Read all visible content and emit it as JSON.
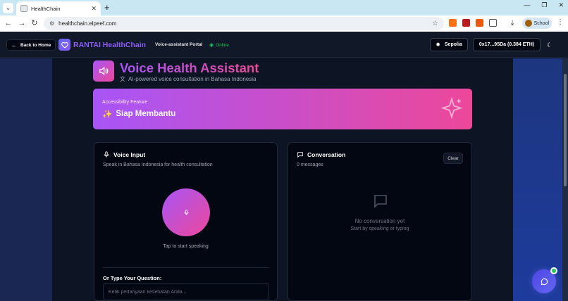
{
  "browser": {
    "tab_title": "HealthChain",
    "url": "healthchain.elpeef.com",
    "profile_label": "School"
  },
  "header": {
    "back_label": "Back to Home",
    "brand_name": "RANTAI HealthChain",
    "portal_label": "Voice-assistant Portal",
    "status_label": "Online",
    "network_label": "Sepolia",
    "wallet_label": "0x17...95Da (0.384 ETH)"
  },
  "hero": {
    "title": "Voice Health Assistant",
    "subtitle": "AI-powered voice consultation in Bahasa Indonesia"
  },
  "banner": {
    "label": "Accessibility Feature",
    "title": "Siap Membantu",
    "emoji": "✨"
  },
  "voice_card": {
    "title": "Voice Input",
    "subtitle": "Speak in Bahasa Indonesia for health consultation",
    "tap_label": "Tap to start speaking",
    "type_label": "Or Type Your Question:",
    "input_placeholder": "Ketik pertanyaan kesehatan Anda...",
    "input_value": ""
  },
  "conversation_card": {
    "title": "Conversation",
    "count_label": "0 messages",
    "clear_label": "Clear",
    "empty_title": "No conversation yet",
    "empty_subtitle": "Start by speaking or typing"
  },
  "colors": {
    "accent_purple": "#a855f7",
    "accent_pink": "#ec4899",
    "brand_indigo": "#8b5cf6",
    "online_green": "#22c55e",
    "background": "#0b1120"
  },
  "icons": {
    "back": "arrow-left-icon",
    "brand": "heart-icon",
    "network": "sun-icon",
    "theme": "moon-icon",
    "hero": "speaker-icon",
    "translate": "translate-icon",
    "banner": "sparkle-icon",
    "voice": "microphone-icon",
    "conversation": "message-square-icon",
    "fab": "chat-icon"
  }
}
